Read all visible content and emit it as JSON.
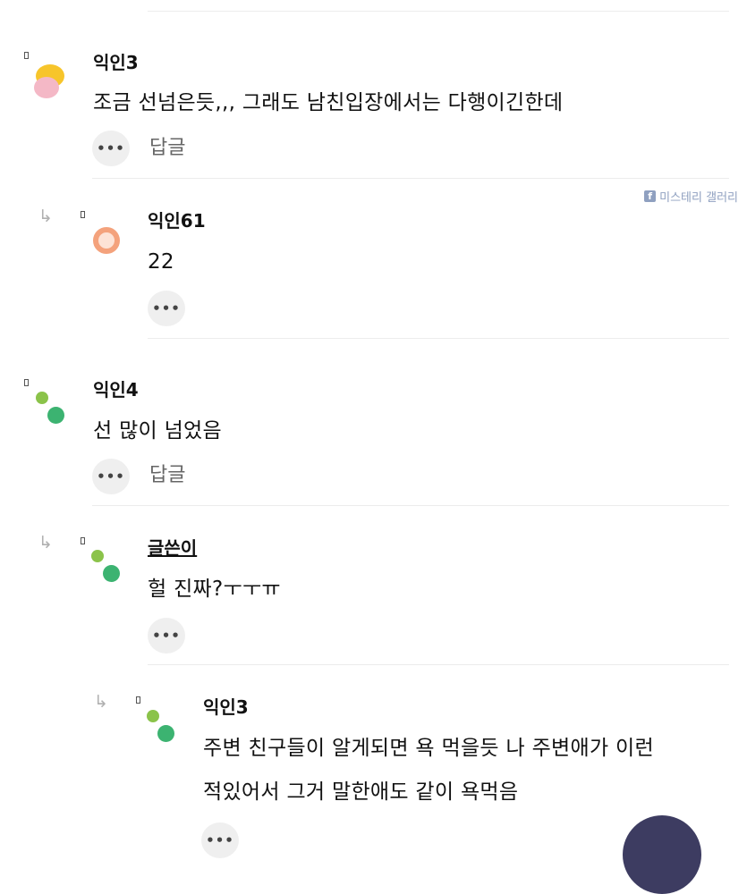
{
  "watermark": {
    "icon": "f",
    "text": "미스테리 갤러리"
  },
  "comments": [
    {
      "author": "익인3",
      "text": "조금 선넘은듯,,, 그래도 남친입장에서는 다행이긴한데",
      "more": "•••",
      "reply_label": "답글"
    },
    {
      "author": "익인61",
      "text": "22",
      "more": "•••"
    },
    {
      "author": "익인4",
      "text": "선 많이 넘었음",
      "more": "•••",
      "reply_label": "답글"
    },
    {
      "author": "글쓴이",
      "text": "헐 진짜?ㅜㅜㅠ",
      "more": "•••"
    },
    {
      "author": "익인3",
      "text_line1": "주변 친구들이 알게되면 욕 먹을듯 나 주변애가 이런",
      "text_line2": "적있어서 그거 말한애도 같이 욕먹음",
      "more": "•••"
    }
  ],
  "colors": {
    "fab": "#3d3c61",
    "avatar_green_light": "#8bc34a",
    "avatar_green_dark": "#3cb371",
    "avatar_orange": "#f4a27c",
    "avatar_yellow": "#f7c52b",
    "avatar_pink": "#f4b8c6"
  }
}
